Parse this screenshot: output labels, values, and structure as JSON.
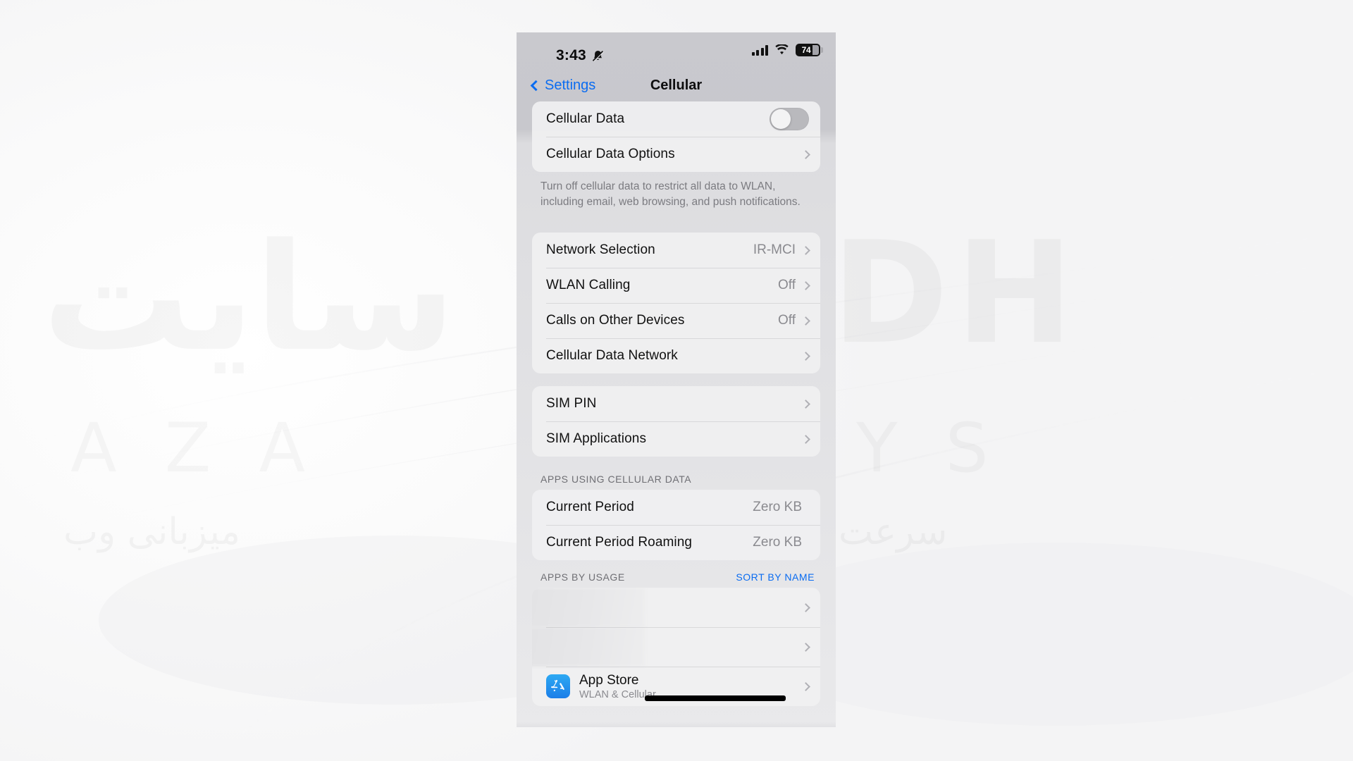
{
  "status_bar": {
    "time": "3:43",
    "silent_icon": "bell-slash-icon",
    "signal_icon": "cellular-bars-icon",
    "wifi_icon": "wifi-icon",
    "battery_percent": "74"
  },
  "nav": {
    "back_label": "Settings",
    "back_icon": "chevron-left-icon",
    "title": "Cellular"
  },
  "section_data": {
    "rows": [
      {
        "label": "Cellular Data",
        "control": "toggle",
        "toggle_on": false
      },
      {
        "label": "Cellular Data Options",
        "control": "chevron"
      }
    ],
    "footnote": "Turn off cellular data to restrict all data to WLAN, including email, web browsing, and push notifications."
  },
  "section_network": {
    "rows": [
      {
        "label": "Network Selection",
        "value": "IR-MCI"
      },
      {
        "label": "WLAN Calling",
        "value": "Off"
      },
      {
        "label": "Calls on Other Devices",
        "value": "Off"
      },
      {
        "label": "Cellular Data Network",
        "value": ""
      }
    ]
  },
  "section_sim": {
    "rows": [
      {
        "label": "SIM PIN",
        "value": ""
      },
      {
        "label": "SIM Applications",
        "value": ""
      }
    ]
  },
  "section_usage": {
    "header": "APPS USING CELLULAR DATA",
    "rows": [
      {
        "label": "Current Period",
        "value": "Zero KB"
      },
      {
        "label": "Current Period Roaming",
        "value": "Zero KB"
      }
    ]
  },
  "section_apps": {
    "header": "APPS BY USAGE",
    "action": "SORT BY NAME",
    "rows": [
      {
        "name": "",
        "sub": "",
        "blurred": true
      },
      {
        "name": "",
        "sub": "",
        "blurred": true
      },
      {
        "name": "App Store",
        "sub": "WLAN & Cellular",
        "icon": "app-store-icon",
        "blurred": false,
        "redacted": true
      }
    ]
  },
  "watermark": {
    "arabic_main": "سایت",
    "latin_main": "DH",
    "latin_sub": "AZA",
    "latin_sub2": "YS",
    "arabic_sub": "میزبانی وب",
    "arabic_sub2": "سرعت"
  },
  "colors": {
    "accent_blue": "#0a6cf1",
    "phone_bg": "#c9c9ce",
    "card_bg": "#f0f0f1",
    "secondary_text": "#8a8a8f"
  }
}
